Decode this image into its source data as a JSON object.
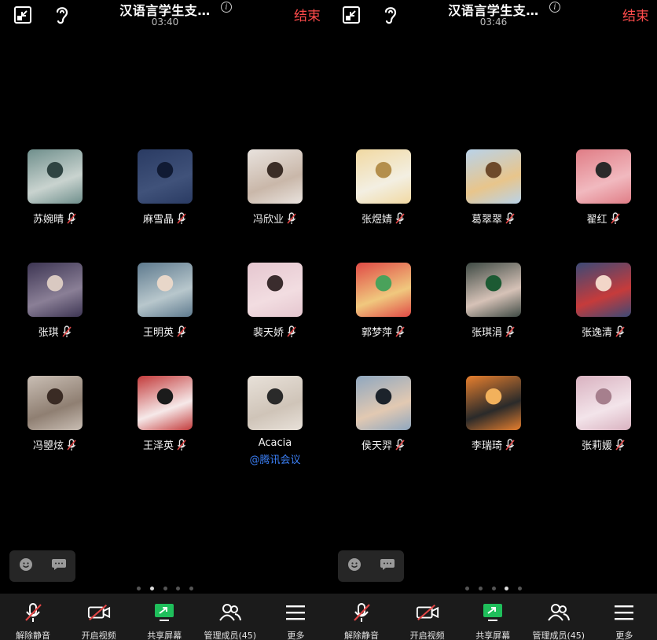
{
  "left": {
    "title": "汉语言学生支…",
    "timer": "03:40",
    "end_label": "结束",
    "active_page": 1,
    "participants": [
      {
        "name": "苏婉晴",
        "muted": true,
        "colors": [
          "#6f8f8c",
          "#c9d3cf",
          "#2f4442"
        ]
      },
      {
        "name": "麻雪晶",
        "muted": true,
        "colors": [
          "#2a3b63",
          "#40527a",
          "#101a33"
        ]
      },
      {
        "name": "冯欣业",
        "muted": true,
        "colors": [
          "#e9e3de",
          "#c9b7a9",
          "#3b2d26"
        ]
      },
      {
        "name": "张琪",
        "muted": true,
        "colors": [
          "#3d3553",
          "#8a7f96",
          "#d9c9c1"
        ]
      },
      {
        "name": "王明英",
        "muted": true,
        "colors": [
          "#5e7a8e",
          "#b8c7cc",
          "#e8d7c9"
        ]
      },
      {
        "name": "裴天娇",
        "muted": true,
        "colors": [
          "#e5c6cf",
          "#f2dde1",
          "#3a2c2d"
        ]
      },
      {
        "name": "冯曌炫",
        "muted": true,
        "colors": [
          "#c9beb4",
          "#8f7f72",
          "#3a2b24"
        ]
      },
      {
        "name": "王泽英",
        "muted": true,
        "colors": [
          "#c33b3b",
          "#f6e9e9",
          "#1b1b1b"
        ]
      },
      {
        "name": "Acacia",
        "sub": "@腾讯会议",
        "muted": false,
        "colors": [
          "#e8e1d9",
          "#cfc4b8",
          "#2a2a2a"
        ]
      }
    ]
  },
  "right": {
    "title": "汉语言学生支…",
    "timer": "03:46",
    "end_label": "结束",
    "active_page": 3,
    "participants": [
      {
        "name": "张煜婧",
        "muted": true,
        "colors": [
          "#f1d9a2",
          "#f3efe2",
          "#b48f4c"
        ]
      },
      {
        "name": "葛翠翠",
        "muted": true,
        "colors": [
          "#b9d3ea",
          "#e8c58b",
          "#6e4a2b"
        ]
      },
      {
        "name": "翟红",
        "muted": true,
        "colors": [
          "#e07d86",
          "#f1b9bf",
          "#2a2a2a"
        ]
      },
      {
        "name": "郭梦萍",
        "muted": true,
        "colors": [
          "#e04a45",
          "#f0c87e",
          "#4aa25b"
        ]
      },
      {
        "name": "张琪涓",
        "muted": true,
        "colors": [
          "#3e4a44",
          "#d6c2b7",
          "#1c5a33"
        ]
      },
      {
        "name": "张逸清",
        "muted": true,
        "colors": [
          "#3b4a77",
          "#c63b3b",
          "#f2d6c8"
        ]
      },
      {
        "name": "侯天羿",
        "muted": true,
        "colors": [
          "#8fa7bf",
          "#e2c9b2",
          "#1c232b"
        ]
      },
      {
        "name": "李瑞琦",
        "muted": true,
        "colors": [
          "#e77f2e",
          "#2a2a2a",
          "#f2b15c"
        ]
      },
      {
        "name": "张莉媛",
        "muted": true,
        "colors": [
          "#d9b2c0",
          "#f3e4ea",
          "#a67f8d"
        ]
      }
    ]
  },
  "page_dots": 5,
  "toolbar": [
    {
      "label": "解除静音",
      "icon": "mic-off-icon"
    },
    {
      "label": "开启视频",
      "icon": "camera-off-icon"
    },
    {
      "label": "共享屏幕",
      "icon": "share-screen-icon"
    },
    {
      "label": "管理成员(45)",
      "icon": "members-icon"
    },
    {
      "label": "更多",
      "icon": "menu-icon"
    }
  ],
  "colors": {
    "end": "#ff4b4b",
    "accent": "#3b7ff5",
    "share_green": "#1fbf5b",
    "mute_red": "#e24646"
  }
}
